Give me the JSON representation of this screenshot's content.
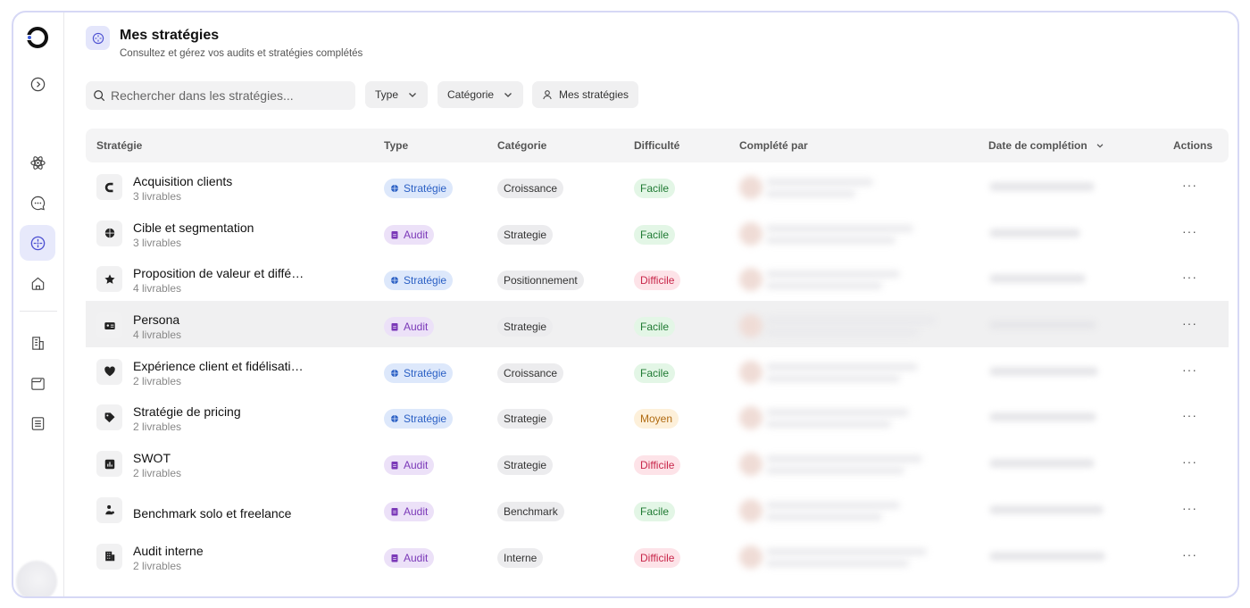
{
  "header": {
    "title": "Mes stratégies",
    "subtitle": "Consultez et gérez vos audits et stratégies complétés"
  },
  "toolbar": {
    "search_placeholder": "Rechercher dans les stratégies...",
    "type_label": "Type",
    "category_label": "Catégorie",
    "mine_label": "Mes stratégies"
  },
  "table": {
    "columns": {
      "strategy": "Stratégie",
      "type": "Type",
      "category": "Catégorie",
      "difficulty": "Difficulté",
      "completed_by": "Complété par",
      "date": "Date de complétion",
      "actions": "Actions"
    },
    "rows": [
      {
        "name": "Acquisition clients",
        "sub": "3 livrables",
        "type": "Stratégie",
        "category": "Croissance",
        "difficulty": "Facile",
        "icon": "magnet-icon"
      },
      {
        "name": "Cible et segmentation",
        "sub": "3 livrables",
        "type": "Audit",
        "category": "Strategie",
        "difficulty": "Facile",
        "icon": "target-icon"
      },
      {
        "name": "Proposition de valeur et diffé…",
        "sub": "4 livrables",
        "type": "Stratégie",
        "category": "Positionnement",
        "difficulty": "Difficile",
        "icon": "star-icon"
      },
      {
        "name": "Persona",
        "sub": "4 livrables",
        "type": "Audit",
        "category": "Strategie",
        "difficulty": "Facile",
        "icon": "id-card-icon"
      },
      {
        "name": "Expérience client et fidélisati…",
        "sub": "2 livrables",
        "type": "Stratégie",
        "category": "Croissance",
        "difficulty": "Facile",
        "icon": "heart-icon"
      },
      {
        "name": "Stratégie de pricing",
        "sub": "2 livrables",
        "type": "Stratégie",
        "category": "Strategie",
        "difficulty": "Moyen",
        "icon": "tag-icon"
      },
      {
        "name": "SWOT",
        "sub": "2 livrables",
        "type": "Audit",
        "category": "Strategie",
        "difficulty": "Difficile",
        "icon": "grid-chart-icon"
      },
      {
        "name": "Benchmark solo et freelance",
        "sub": "",
        "type": "Audit",
        "category": "Benchmark",
        "difficulty": "Facile",
        "icon": "person-icon"
      },
      {
        "name": "Audit interne",
        "sub": "2 livrables",
        "type": "Audit",
        "category": "Interne",
        "difficulty": "Difficile",
        "icon": "building-icon"
      }
    ]
  },
  "colors": {
    "accent": "#5b5fd6",
    "strategie_bg": "#dde8fb",
    "audit_bg": "#ece1f8",
    "easy": "#1f7a33",
    "hard": "#c8274a",
    "medium": "#b06a10"
  }
}
